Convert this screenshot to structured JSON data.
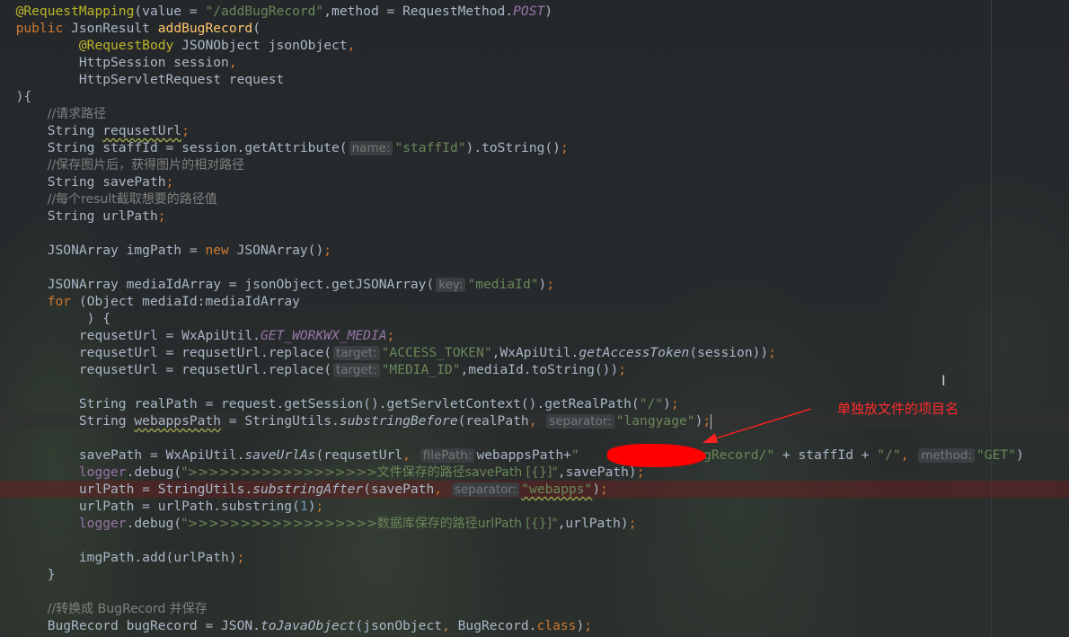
{
  "annotation": {
    "label": "单独放文件的项目名"
  },
  "cursor": {
    "glyph": "Ⅰ"
  },
  "colors": {
    "keyword": "#cc7832",
    "string": "#6a8759",
    "comment": "#808080",
    "annotation": "#bbb529",
    "field": "#9876aa",
    "method": "#ffc66d",
    "number": "#6897bb",
    "text": "#a9b7c6",
    "marker": "#ff0000"
  },
  "code": {
    "l1": [
      "@RequestMapping",
      "(value = ",
      "\"/addBugRecord\"",
      ",method = RequestMethod.",
      "POST",
      ")"
    ],
    "l2": [
      "public ",
      "JsonResult ",
      "addBugRecord",
      "("
    ],
    "l3": [
      "        ",
      "@RequestBody",
      " JSONObject jsonObject",
      ","
    ],
    "l4": [
      "        HttpSession session",
      ","
    ],
    "l5": [
      "        HttpServletRequest request"
    ],
    "l6": [
      "){"
    ],
    "l7": [
      "    ",
      "//请求路径"
    ],
    "l8": [
      "    String ",
      "requsetUrl",
      ";"
    ],
    "l9": [
      "    String staffId = session.getAttribute(",
      "name:",
      "\"staffId\"",
      ").toString()",
      ";"
    ],
    "l10": [
      "    ",
      "//保存图片后，获得图片的相对路径"
    ],
    "l11": [
      "    String savePath",
      ";"
    ],
    "l12": [
      "    ",
      "//每个result截取想要的路径值"
    ],
    "l13": [
      "    String urlPath",
      ";"
    ],
    "l14": [
      "    JSONArray imgPath = ",
      "new ",
      "JSONArray()",
      ";"
    ],
    "l15": [
      "    JSONArray mediaIdArray = jsonObject.getJSONArray(",
      "key:",
      "\"mediaId\"",
      ")",
      ";"
    ],
    "l16": [
      "    ",
      "for ",
      "(Object mediaId:mediaIdArray"
    ],
    "l17": [
      "         ) {"
    ],
    "l18": [
      "        requsetUrl = WxApiUtil.",
      "GET_WORKWX_MEDIA",
      ";"
    ],
    "l19": [
      "        requsetUrl = requsetUrl.replace(",
      "target:",
      "\"ACCESS_TOKEN\"",
      ",WxApiUtil.",
      "getAccessToken",
      "(session))",
      ";"
    ],
    "l20": [
      "        requsetUrl = requsetUrl.replace(",
      "target:",
      "\"MEDIA_ID\"",
      ",mediaId.toString())",
      ";"
    ],
    "l21": [
      "        String realPath = request.getSession().getServletContext().getRealPath(",
      "\"/\"",
      ")",
      ";"
    ],
    "l22": [
      "        String ",
      "webappsPath",
      " = StringUtils.",
      "substringBefore",
      "(realPath",
      ", ",
      "separator:",
      "\"langyage\"",
      ")",
      ";"
    ],
    "l23": [
      "        savePath = WxApiUtil.",
      "saveUrlAs",
      "(requsetUrl",
      ", ",
      "filePath:",
      "webappsPath+",
      "\"",
      "/bugRecord/\"",
      " + staffId + ",
      "\"/\"",
      ", ",
      "method:",
      "\"GET\"",
      ")"
    ],
    "l24": [
      "        ",
      "logger",
      ".debug(",
      "\">>>>>>>>>>>>>>>>>>文件保存的路径savePath [{}]\"",
      ",savePath)",
      ";"
    ],
    "l25": [
      "        urlPath = StringUtils.",
      "substringAfter",
      "(savePath",
      ", ",
      "separator:",
      "\"webapps\"",
      ")",
      ";"
    ],
    "l26": [
      "        urlPath = urlPath.substring(",
      "1",
      ")",
      ";"
    ],
    "l27": [
      "        ",
      "logger",
      ".debug(",
      "\">>>>>>>>>>>>>>>>>>数据库保存的路径urlPath [{}]\"",
      ",urlPath)",
      ";"
    ],
    "l28": [
      "        imgPath.add(urlPath)",
      ";"
    ],
    "l29": [
      "    }"
    ],
    "l30": [
      "    ",
      "//转换成 BugRecord 并保存"
    ],
    "l31": [
      "    BugRecord bugRecord = JSON.",
      "toJavaObject",
      "(jsonObject",
      ", ",
      "BugRecord.",
      "class",
      ")",
      ";"
    ]
  }
}
